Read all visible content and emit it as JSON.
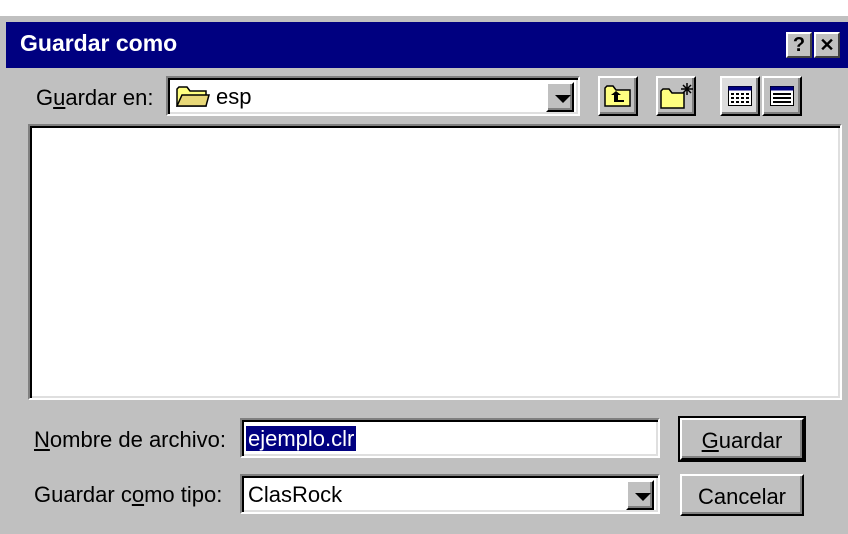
{
  "window": {
    "title": "Guardar como"
  },
  "titlebar_buttons": {
    "help": "?",
    "close": "✕"
  },
  "save_in": {
    "label_pre": "G",
    "label_u": "u",
    "label_post": "ardar en:",
    "value": "esp",
    "icon": "folder-icon"
  },
  "toolbar": {
    "up_icon": "up-one-level-icon",
    "new_folder_icon": "new-folder-icon",
    "list_icon": "list-view-icon",
    "details_icon": "details-view-icon"
  },
  "file_name": {
    "label_u": "N",
    "label_post": "ombre de archivo:",
    "value": "ejemplo.clr"
  },
  "file_type": {
    "label_pre": "Guardar c",
    "label_u": "o",
    "label_post": "mo tipo:",
    "value": "ClasRock"
  },
  "buttons": {
    "save_u": "G",
    "save_post": "uardar",
    "cancel": "Cancelar"
  }
}
